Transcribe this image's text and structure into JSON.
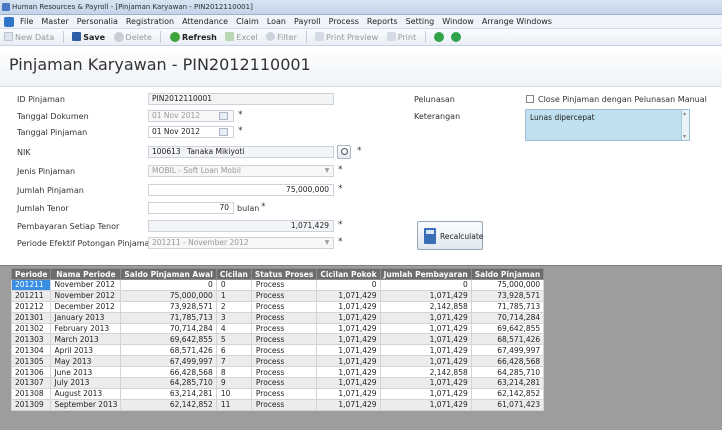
{
  "window_title": "Human Resources & Payroll - [Pinjaman Karyawan - PIN2012110001]",
  "menu": [
    "File",
    "Master",
    "Personalia",
    "Registration",
    "Attendance",
    "Claim",
    "Loan",
    "Payroll",
    "Process",
    "Reports",
    "Setting",
    "Window",
    "Arrange Windows"
  ],
  "toolbar": {
    "new": "New Data",
    "save": "Save",
    "delete": "Delete",
    "refresh": "Refresh",
    "excel": "Excel",
    "filter": "Filter",
    "print_preview": "Print Preview",
    "print": "Print"
  },
  "page_title": "Pinjaman Karyawan - PIN2012110001",
  "form": {
    "id_label": "ID Pinjaman",
    "id_value": "PIN2012110001",
    "tgl_dok_label": "Tanggal Dokumen",
    "tgl_dok_value": "01 Nov 2012",
    "tgl_pin_label": "Tanggal Pinjaman",
    "tgl_pin_value": "01 Nov 2012",
    "nik_label": "NIK",
    "nik_value": "100613",
    "nama_value": "Tanaka Mikiyoti",
    "jenis_label": "Jenis Pinjaman",
    "jenis_value": "MOBIL - Soft Loan Mobil",
    "jumlah_label": "Jumlah Pinjaman",
    "jumlah_value": "75,000,000",
    "tenor_label": "Jumlah Tenor",
    "tenor_value": "70",
    "tenor_unit": "bulan",
    "bayar_label": "Pembayaran Setiap Tenor",
    "bayar_value": "1,071,429",
    "periode_label": "Periode Efektif Potongan Pinjaman",
    "periode_value": "201211 - November 2012",
    "pelunasan_label": "Pelunasan",
    "pelunasan_check": "Close Pinjaman dengan Pelunasan Manual",
    "keterangan_label": "Keterangan",
    "keterangan_value": "Lunas dipercepat",
    "required_mark": "*",
    "recalc": "Recalculate"
  },
  "grid": {
    "headers": [
      "Periode",
      "Nama Periode",
      "Saldo Pinjaman Awal",
      "Cicilan",
      "Status Proses",
      "Cicilan Pokok",
      "Jumlah Pembayaran",
      "Saldo Pinjaman"
    ],
    "rows": [
      [
        "201211",
        "November 2012",
        "0",
        "0",
        "Process",
        "0",
        "0",
        "75,000,000"
      ],
      [
        "201211",
        "November 2012",
        "75,000,000",
        "1",
        "Process",
        "1,071,429",
        "1,071,429",
        "73,928,571"
      ],
      [
        "201212",
        "December 2012",
        "73,928,571",
        "2",
        "Process",
        "1,071,429",
        "2,142,858",
        "71,785,713"
      ],
      [
        "201301",
        "January 2013",
        "71,785,713",
        "3",
        "Process",
        "1,071,429",
        "1,071,429",
        "70,714,284"
      ],
      [
        "201302",
        "February 2013",
        "70,714,284",
        "4",
        "Process",
        "1,071,429",
        "1,071,429",
        "69,642,855"
      ],
      [
        "201303",
        "March 2013",
        "69,642,855",
        "5",
        "Process",
        "1,071,429",
        "1,071,429",
        "68,571,426"
      ],
      [
        "201304",
        "April 2013",
        "68,571,426",
        "6",
        "Process",
        "1,071,429",
        "1,071,429",
        "67,499,997"
      ],
      [
        "201305",
        "May 2013",
        "67,499,997",
        "7",
        "Process",
        "1,071,429",
        "1,071,429",
        "66,428,568"
      ],
      [
        "201306",
        "June 2013",
        "66,428,568",
        "8",
        "Process",
        "1,071,429",
        "2,142,858",
        "64,285,710"
      ],
      [
        "201307",
        "July 2013",
        "64,285,710",
        "9",
        "Process",
        "1,071,429",
        "1,071,429",
        "63,214,281"
      ],
      [
        "201308",
        "August 2013",
        "63,214,281",
        "10",
        "Process",
        "1,071,429",
        "1,071,429",
        "62,142,852"
      ],
      [
        "201309",
        "September 2013",
        "62,142,852",
        "11",
        "Process",
        "1,071,429",
        "1,071,429",
        "61,071,423"
      ]
    ]
  }
}
